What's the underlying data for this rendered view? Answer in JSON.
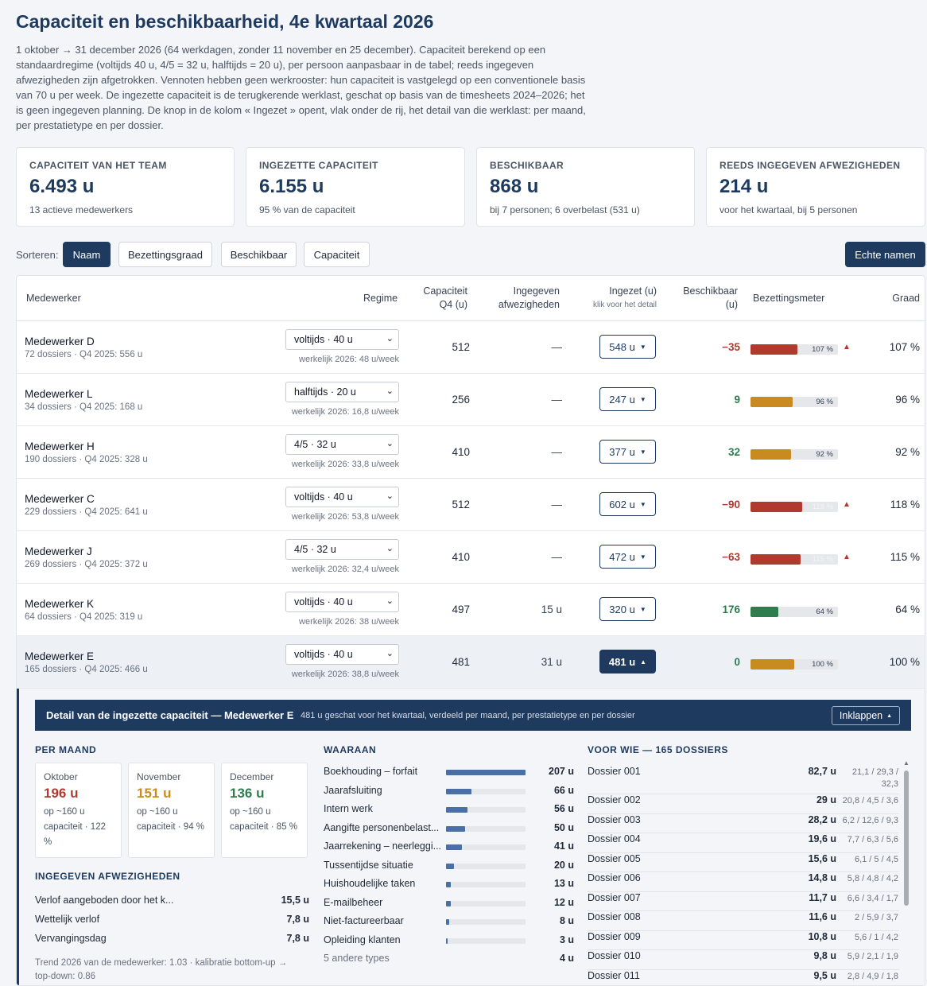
{
  "title": "Capaciteit en beschikbaarheid, 4e kwartaal 2026",
  "intro": "1 oktober → 31 december 2026 (64 werkdagen, zonder 11 november en 25 december). Capaciteit berekend op een standaardregime (voltijds 40 u, 4/5 = 32 u, halftijds = 20 u), per persoon aanpasbaar in de tabel; reeds ingegeven afwezigheden zijn afgetrokken. Vennoten hebben geen werkrooster: hun capaciteit is vastgelegd op een conventionele basis van 70 u per week. De ingezette capaciteit is de terugkerende werklast, geschat op basis van de timesheets 2024–2026; het is geen ingegeven planning. De knop in de kolom « Ingezet » opent, vlak onder de rij, het detail van die werklast: per maand, per prestatietype en per dossier.",
  "kpis": [
    {
      "label": "CAPACITEIT VAN HET TEAM",
      "value": "6.493 u",
      "sub": "13 actieve medewerkers"
    },
    {
      "label": "INGEZETTE CAPACITEIT",
      "value": "6.155 u",
      "sub": "95 % van de capaciteit"
    },
    {
      "label": "BESCHIKBAAR",
      "value": "868 u",
      "sub": "bij 7 personen; 6 overbelast (531 u)"
    },
    {
      "label": "REEDS INGEGEVEN AFWEZIGHEDEN",
      "value": "214 u",
      "sub": "voor het kwartaal, bij 5 personen"
    }
  ],
  "sort": {
    "label": "Sorteren:",
    "buttons": [
      "Naam",
      "Bezettingsgraad",
      "Beschikbaar",
      "Capaciteit"
    ],
    "active": "Naam"
  },
  "real_names_button": "Echte namen",
  "headers": {
    "employee": "Medewerker",
    "regime": "Regime",
    "capacity_1": "Capaciteit",
    "capacity_2": "Q4 (u)",
    "absences_1": "Ingegeven",
    "absences_2": "afwezigheden",
    "assigned": "Ingezet (u)",
    "assigned_hint": "klik voor het detail",
    "available_1": "Beschikbaar",
    "available_2": "(u)",
    "meter": "Bezettingsmeter",
    "grade": "Graad"
  },
  "rows": [
    {
      "name": "Medewerker D",
      "meta": "72 dossiers · Q4 2025: 556 u",
      "regime": "voltijds · 40 u",
      "real": "werkelijk 2026: 48 u/week",
      "capacity": "512",
      "absences": "—",
      "assigned": "548 u",
      "available": "−35",
      "avail_color": "#b03a2e",
      "occupancy": 107,
      "meter_color": "#b03a2e",
      "pct_label": "107 %",
      "warn": true,
      "grade": "107 %",
      "open": false
    },
    {
      "name": "Medewerker L",
      "meta": "34 dossiers · Q4 2025: 168 u",
      "regime": "halftijds · 20 u",
      "real": "werkelijk 2026: 16,8 u/week",
      "capacity": "256",
      "absences": "—",
      "assigned": "247 u",
      "available": "9",
      "avail_color": "#2e7d4f",
      "occupancy": 96,
      "meter_color": "#c98a1f",
      "pct_label": "96 %",
      "warn": false,
      "grade": "96 %",
      "open": false
    },
    {
      "name": "Medewerker H",
      "meta": "190 dossiers · Q4 2025: 328 u",
      "regime": "4/5 · 32 u",
      "real": "werkelijk 2026: 33,8 u/week",
      "capacity": "410",
      "absences": "—",
      "assigned": "377 u",
      "available": "32",
      "avail_color": "#2e7d4f",
      "occupancy": 92,
      "meter_color": "#c98a1f",
      "pct_label": "92 %",
      "warn": false,
      "grade": "92 %",
      "open": false
    },
    {
      "name": "Medewerker C",
      "meta": "229 dossiers · Q4 2025: 641 u",
      "regime": "voltijds · 40 u",
      "real": "werkelijk 2026: 53,8 u/week",
      "capacity": "512",
      "absences": "—",
      "assigned": "602 u",
      "available": "−90",
      "avail_color": "#b03a2e",
      "occupancy": 118,
      "meter_color": "#b03a2e",
      "pct_label": "118 %",
      "warn": true,
      "grade": "118 %",
      "open": false
    },
    {
      "name": "Medewerker J",
      "meta": "269 dossiers · Q4 2025: 372 u",
      "regime": "4/5 · 32 u",
      "real": "werkelijk 2026: 32,4 u/week",
      "capacity": "410",
      "absences": "—",
      "assigned": "472 u",
      "available": "−63",
      "avail_color": "#b03a2e",
      "occupancy": 115,
      "meter_color": "#b03a2e",
      "pct_label": "115 %",
      "warn": true,
      "grade": "115 %",
      "open": false
    },
    {
      "name": "Medewerker K",
      "meta": "64 dossiers · Q4 2025: 319 u",
      "regime": "voltijds · 40 u",
      "real": "werkelijk 2026: 38 u/week",
      "capacity": "497",
      "absences": "15 u",
      "assigned": "320 u",
      "available": "176",
      "avail_color": "#2e7d4f",
      "occupancy": 64,
      "meter_color": "#2e7d4f",
      "pct_label": "64 %",
      "warn": false,
      "grade": "64 %",
      "open": false
    },
    {
      "name": "Medewerker E",
      "meta": "165 dossiers · Q4 2025: 466 u",
      "regime": "voltijds · 40 u",
      "real": "werkelijk 2026: 38,8 u/week",
      "capacity": "481",
      "absences": "31 u",
      "assigned": "481 u",
      "available": "0",
      "avail_color": "#2e7d4f",
      "occupancy": 100,
      "meter_color": "#c98a1f",
      "pct_label": "100 %",
      "warn": false,
      "grade": "100 %",
      "open": true
    }
  ],
  "detail": {
    "title": "Detail van de ingezette capaciteit — Medewerker E",
    "subtitle": "481 u geschat voor het kwartaal, verdeeld per maand, per prestatietype en per dossier",
    "collapse": "Inklappen",
    "per_month_title": "PER MAAND",
    "months": [
      {
        "name": "Oktober",
        "value": "196 u",
        "color": "#b03a2e",
        "basis": "op ~160 u",
        "cap": "capaciteit · 122 %"
      },
      {
        "name": "November",
        "value": "151 u",
        "color": "#c98a1f",
        "basis": "op ~160 u",
        "cap": "capaciteit · 94 %"
      },
      {
        "name": "December",
        "value": "136 u",
        "color": "#2e7d4f",
        "basis": "op ~160 u",
        "cap": "capaciteit · 85 %"
      }
    ],
    "absences_title": "INGEGEVEN AFWEZIGHEDEN",
    "absences": [
      {
        "label": "Verlof aangeboden door het k...",
        "value": "15,5 u"
      },
      {
        "label": "Wettelijk verlof",
        "value": "7,8 u"
      },
      {
        "label": "Vervangingsdag",
        "value": "7,8 u"
      }
    ],
    "trend": "Trend 2026 van de medewerker: 1.03 · kalibratie bottom-up → top-down: 0.86",
    "types_title": "WAARAAN",
    "types": [
      {
        "label": "Boekhouding – forfait",
        "hours": 207,
        "value": "207 u"
      },
      {
        "label": "Jaarafsluiting",
        "hours": 66,
        "value": "66 u"
      },
      {
        "label": "Intern werk",
        "hours": 56,
        "value": "56 u"
      },
      {
        "label": "Aangifte personenbelast...",
        "hours": 50,
        "value": "50 u"
      },
      {
        "label": "Jaarrekening – neerleggi...",
        "hours": 41,
        "value": "41 u"
      },
      {
        "label": "Tussentijdse situatie",
        "hours": 20,
        "value": "20 u"
      },
      {
        "label": "Huishoudelijke taken",
        "hours": 13,
        "value": "13 u"
      },
      {
        "label": "E-mailbeheer",
        "hours": 12,
        "value": "12 u"
      },
      {
        "label": "Niet-factureerbaar",
        "hours": 8,
        "value": "8 u"
      },
      {
        "label": "Opleiding klanten",
        "hours": 3,
        "value": "3 u"
      }
    ],
    "other_types": {
      "label": "5 andere types",
      "value": "4 u"
    },
    "dossiers_title": "VOOR WIE — 165 DOSSIERS",
    "dossiers": [
      {
        "name": "Dossier 001",
        "value": "82,7 u",
        "months": "21,1 / 29,3 / 32,3"
      },
      {
        "name": "Dossier 002",
        "value": "29 u",
        "months": "20,8 / 4,5 / 3,6"
      },
      {
        "name": "Dossier 003",
        "value": "28,2 u",
        "months": "6,2 / 12,6 / 9,3"
      },
      {
        "name": "Dossier 004",
        "value": "19,6 u",
        "months": "7,7 / 6,3 / 5,6"
      },
      {
        "name": "Dossier 005",
        "value": "15,6 u",
        "months": "6,1 / 5 / 4,5"
      },
      {
        "name": "Dossier 006",
        "value": "14,8 u",
        "months": "5,8 / 4,8 / 4,2"
      },
      {
        "name": "Dossier 007",
        "value": "11,7 u",
        "months": "6,6 / 3,4 / 1,7"
      },
      {
        "name": "Dossier 008",
        "value": "11,6 u",
        "months": "2 / 5,9 / 3,7"
      },
      {
        "name": "Dossier 009",
        "value": "10,8 u",
        "months": "5,6 / 1 / 4,2"
      },
      {
        "name": "Dossier 010",
        "value": "9,8 u",
        "months": "5,9 / 2,1 / 1,9"
      },
      {
        "name": "Dossier 011",
        "value": "9,5 u",
        "months": "2,8 / 4,9 / 1,8"
      }
    ]
  }
}
